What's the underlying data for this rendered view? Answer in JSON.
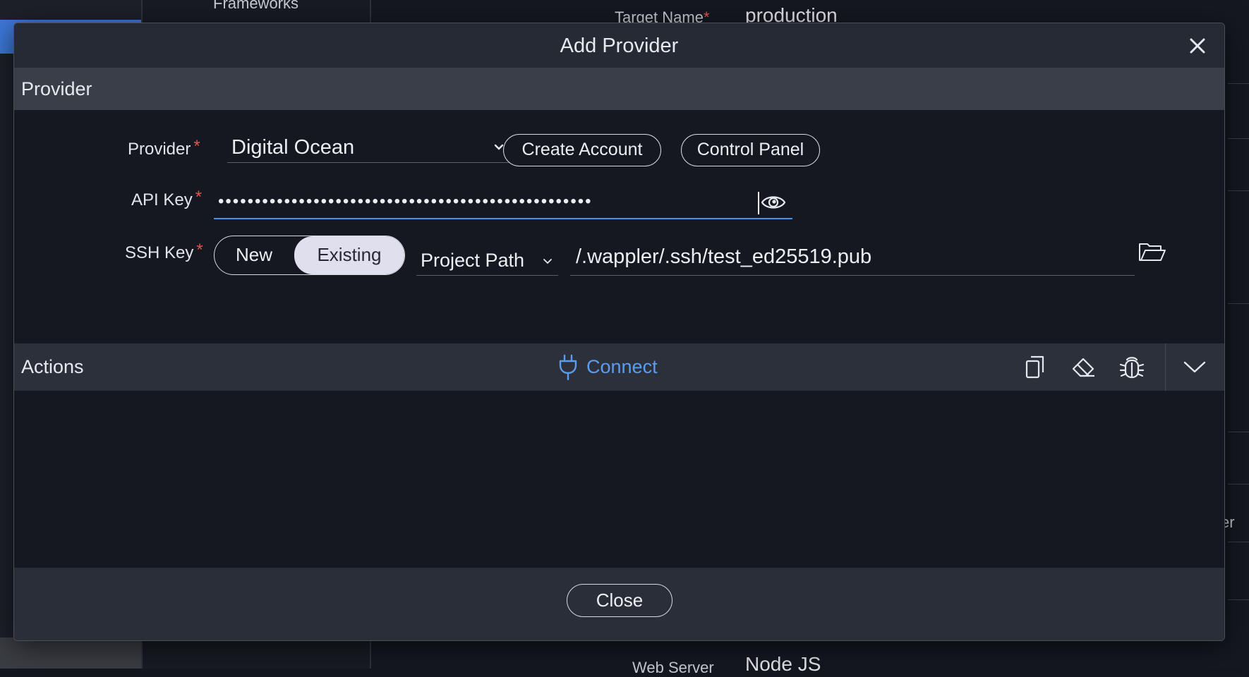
{
  "background": {
    "frameworks_label": "Frameworks",
    "target_name_label": "Target Name",
    "target_name_value": "production",
    "web_server_label": "Web Server",
    "web_server_value": "Node JS",
    "right_edge_text": "er",
    "required_mark": "*"
  },
  "modal": {
    "title": "Add Provider",
    "close_icon": "close-icon",
    "provider_section": {
      "title": "Provider",
      "provider_label": "Provider",
      "provider_value": "Digital Ocean",
      "create_account_label": "Create Account",
      "control_panel_label": "Control Panel",
      "api_key_label": "API Key",
      "api_key_masked": "•••••••••••••••••••••••••••••••••••••••••••••••••••",
      "ssh_key_label": "SSH Key",
      "ssh_options": [
        "New",
        "Existing"
      ],
      "ssh_selected": "Existing",
      "path_type_value": "Project Path",
      "key_path_value": "/.wappler/.ssh/test_ed25519.pub",
      "required_mark": "*"
    },
    "actions_section": {
      "title": "Actions",
      "connect_label": "Connect",
      "icons": [
        "copy-icon",
        "eraser-icon",
        "bug-icon",
        "chevron-down-icon"
      ]
    },
    "footer": {
      "close_label": "Close"
    }
  },
  "colors": {
    "accent_blue": "#5a9cf0",
    "required_red": "#e0564f",
    "selected_toggle": "#dfdfee"
  }
}
